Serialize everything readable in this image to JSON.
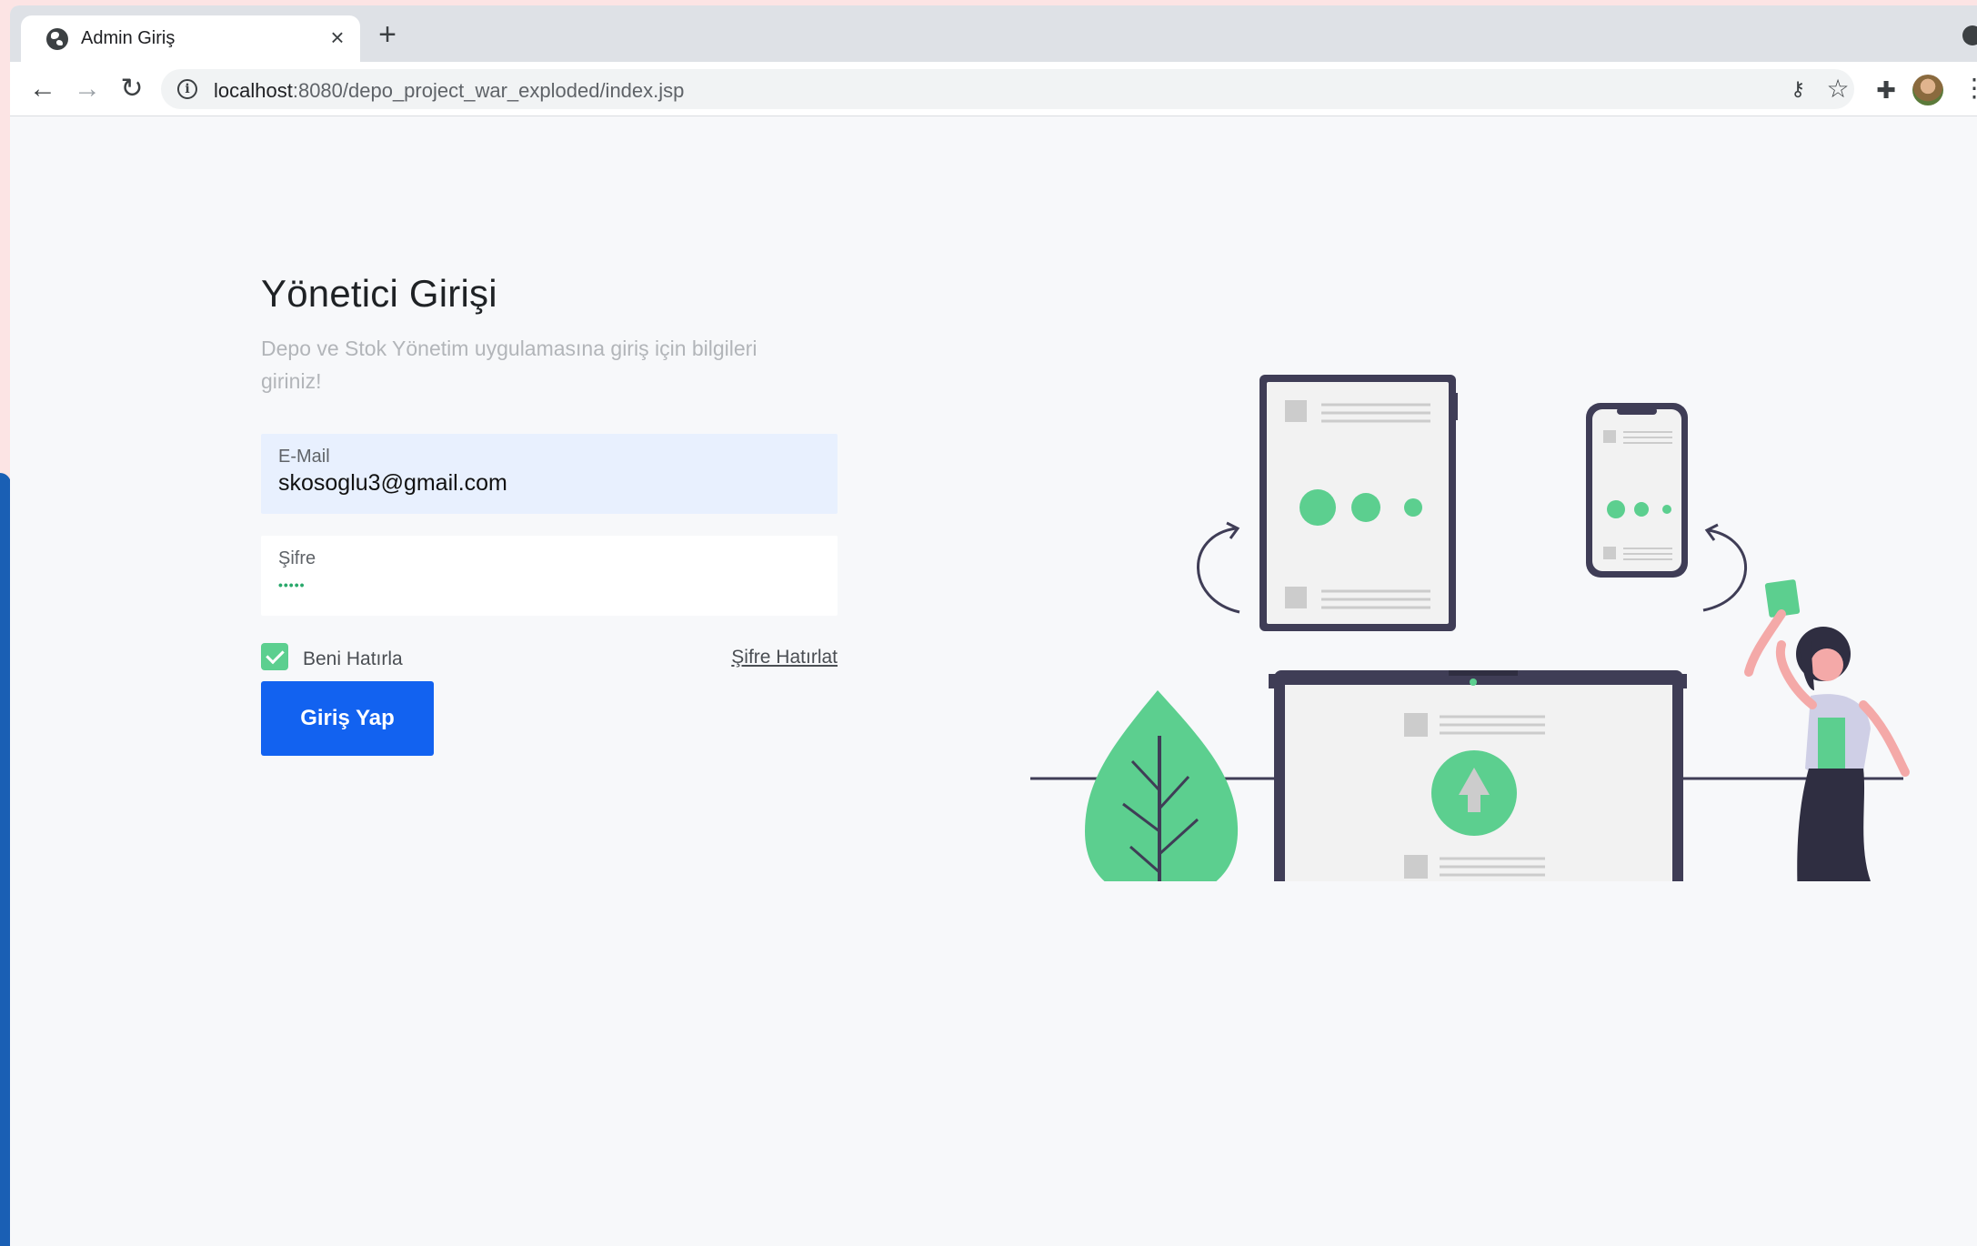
{
  "browser": {
    "tab_title": "Admin Giriş",
    "tab_close": "×",
    "new_tab": "+",
    "url_host": "localhost",
    "url_rest": ":8080/depo_project_war_exploded/index.jsp"
  },
  "login": {
    "title": "Yönetici Girişi",
    "subtitle": "Depo ve Stok Yönetim uygulamasına giriş için bilgileri giriniz!",
    "email_label": "E-Mail",
    "email_value": "skosoglu3@gmail.com",
    "password_label": "Şifre",
    "password_mask": "•••••",
    "remember_label": "Beni Hatırla",
    "remember_checked": true,
    "forgot_label": "Şifre Hatırlat",
    "submit_label": "Giriş Yap"
  },
  "colors": {
    "primary": "#1262f0",
    "accent_green": "#5ccf8f",
    "illustration_dark": "#3f3d56"
  },
  "icons": {
    "tab": "globe-icon",
    "close": "close-icon",
    "back": "arrow-left-icon",
    "forward": "arrow-right-icon",
    "reload": "reload-icon",
    "info": "info-icon",
    "key": "key-icon",
    "star": "star-icon",
    "extensions": "puzzle-icon",
    "menu": "kebab-menu-icon"
  }
}
